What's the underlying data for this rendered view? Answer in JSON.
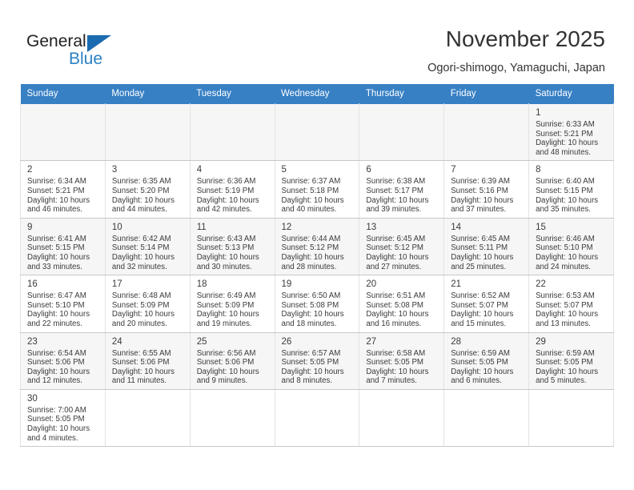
{
  "brand": {
    "name_top": "General",
    "name_bottom": "Blue",
    "accent_color": "#2b81c4",
    "flag_color": "#1b6bb0"
  },
  "header": {
    "title": "November 2025",
    "subtitle": "Ogori-shimogo, Yamaguchi, Japan"
  },
  "theme": {
    "header_bg": "#3880c4",
    "row_alt_bg": "#f6f6f6",
    "text_color": "#3b3b3b"
  },
  "calendar": {
    "weekday_headers": [
      "Sunday",
      "Monday",
      "Tuesday",
      "Wednesday",
      "Thursday",
      "Friday",
      "Saturday"
    ],
    "weeks": [
      [
        {
          "day": "",
          "info": ""
        },
        {
          "day": "",
          "info": ""
        },
        {
          "day": "",
          "info": ""
        },
        {
          "day": "",
          "info": ""
        },
        {
          "day": "",
          "info": ""
        },
        {
          "day": "",
          "info": ""
        },
        {
          "day": "1",
          "info": "Sunrise: 6:33 AM\nSunset: 5:21 PM\nDaylight: 10 hours and 48 minutes."
        }
      ],
      [
        {
          "day": "2",
          "info": "Sunrise: 6:34 AM\nSunset: 5:21 PM\nDaylight: 10 hours and 46 minutes."
        },
        {
          "day": "3",
          "info": "Sunrise: 6:35 AM\nSunset: 5:20 PM\nDaylight: 10 hours and 44 minutes."
        },
        {
          "day": "4",
          "info": "Sunrise: 6:36 AM\nSunset: 5:19 PM\nDaylight: 10 hours and 42 minutes."
        },
        {
          "day": "5",
          "info": "Sunrise: 6:37 AM\nSunset: 5:18 PM\nDaylight: 10 hours and 40 minutes."
        },
        {
          "day": "6",
          "info": "Sunrise: 6:38 AM\nSunset: 5:17 PM\nDaylight: 10 hours and 39 minutes."
        },
        {
          "day": "7",
          "info": "Sunrise: 6:39 AM\nSunset: 5:16 PM\nDaylight: 10 hours and 37 minutes."
        },
        {
          "day": "8",
          "info": "Sunrise: 6:40 AM\nSunset: 5:15 PM\nDaylight: 10 hours and 35 minutes."
        }
      ],
      [
        {
          "day": "9",
          "info": "Sunrise: 6:41 AM\nSunset: 5:15 PM\nDaylight: 10 hours and 33 minutes."
        },
        {
          "day": "10",
          "info": "Sunrise: 6:42 AM\nSunset: 5:14 PM\nDaylight: 10 hours and 32 minutes."
        },
        {
          "day": "11",
          "info": "Sunrise: 6:43 AM\nSunset: 5:13 PM\nDaylight: 10 hours and 30 minutes."
        },
        {
          "day": "12",
          "info": "Sunrise: 6:44 AM\nSunset: 5:12 PM\nDaylight: 10 hours and 28 minutes."
        },
        {
          "day": "13",
          "info": "Sunrise: 6:45 AM\nSunset: 5:12 PM\nDaylight: 10 hours and 27 minutes."
        },
        {
          "day": "14",
          "info": "Sunrise: 6:45 AM\nSunset: 5:11 PM\nDaylight: 10 hours and 25 minutes."
        },
        {
          "day": "15",
          "info": "Sunrise: 6:46 AM\nSunset: 5:10 PM\nDaylight: 10 hours and 24 minutes."
        }
      ],
      [
        {
          "day": "16",
          "info": "Sunrise: 6:47 AM\nSunset: 5:10 PM\nDaylight: 10 hours and 22 minutes."
        },
        {
          "day": "17",
          "info": "Sunrise: 6:48 AM\nSunset: 5:09 PM\nDaylight: 10 hours and 20 minutes."
        },
        {
          "day": "18",
          "info": "Sunrise: 6:49 AM\nSunset: 5:09 PM\nDaylight: 10 hours and 19 minutes."
        },
        {
          "day": "19",
          "info": "Sunrise: 6:50 AM\nSunset: 5:08 PM\nDaylight: 10 hours and 18 minutes."
        },
        {
          "day": "20",
          "info": "Sunrise: 6:51 AM\nSunset: 5:08 PM\nDaylight: 10 hours and 16 minutes."
        },
        {
          "day": "21",
          "info": "Sunrise: 6:52 AM\nSunset: 5:07 PM\nDaylight: 10 hours and 15 minutes."
        },
        {
          "day": "22",
          "info": "Sunrise: 6:53 AM\nSunset: 5:07 PM\nDaylight: 10 hours and 13 minutes."
        }
      ],
      [
        {
          "day": "23",
          "info": "Sunrise: 6:54 AM\nSunset: 5:06 PM\nDaylight: 10 hours and 12 minutes."
        },
        {
          "day": "24",
          "info": "Sunrise: 6:55 AM\nSunset: 5:06 PM\nDaylight: 10 hours and 11 minutes."
        },
        {
          "day": "25",
          "info": "Sunrise: 6:56 AM\nSunset: 5:06 PM\nDaylight: 10 hours and 9 minutes."
        },
        {
          "day": "26",
          "info": "Sunrise: 6:57 AM\nSunset: 5:05 PM\nDaylight: 10 hours and 8 minutes."
        },
        {
          "day": "27",
          "info": "Sunrise: 6:58 AM\nSunset: 5:05 PM\nDaylight: 10 hours and 7 minutes."
        },
        {
          "day": "28",
          "info": "Sunrise: 6:59 AM\nSunset: 5:05 PM\nDaylight: 10 hours and 6 minutes."
        },
        {
          "day": "29",
          "info": "Sunrise: 6:59 AM\nSunset: 5:05 PM\nDaylight: 10 hours and 5 minutes."
        }
      ],
      [
        {
          "day": "30",
          "info": "Sunrise: 7:00 AM\nSunset: 5:05 PM\nDaylight: 10 hours and 4 minutes."
        },
        {
          "day": "",
          "info": ""
        },
        {
          "day": "",
          "info": ""
        },
        {
          "day": "",
          "info": ""
        },
        {
          "day": "",
          "info": ""
        },
        {
          "day": "",
          "info": ""
        },
        {
          "day": "",
          "info": ""
        }
      ]
    ]
  }
}
